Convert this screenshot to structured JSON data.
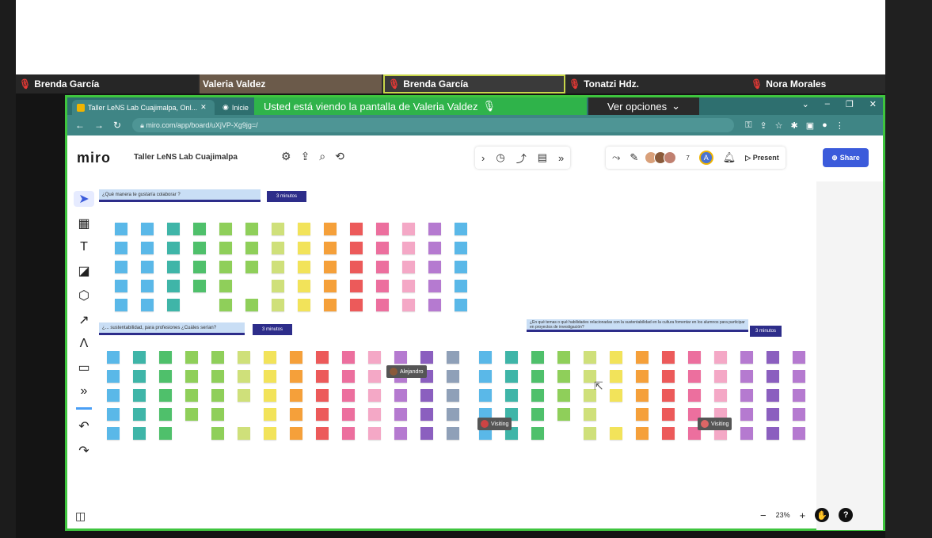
{
  "participants": [
    {
      "name": "Brenda García"
    },
    {
      "name": "Valeria Valdez"
    },
    {
      "name": "Brenda García"
    },
    {
      "name": "Tonatzi Hdz."
    },
    {
      "name": "Nora Morales"
    }
  ],
  "share_banner": {
    "text": "Usted está viendo la pantalla de Valeria Valdez",
    "options": "Ver opciones"
  },
  "browser": {
    "tab_active": "Taller LeNS Lab Cuajimalpa, Onl...",
    "tab_second": "Inicie",
    "url": "miro.com/app/board/uXjVP-Xg9jg=/"
  },
  "miro": {
    "logo": "miro",
    "board_name": "Taller LeNS Lab Cuajimalpa",
    "present": "Present",
    "share": "Share",
    "zoom": "23%",
    "user_initial": "A",
    "collab_count": "7"
  },
  "board": {
    "q1": "¿Qué manera te gustaría colaborar ?",
    "q1_tag": "3 minutos",
    "q2": "¿... sustentabilidad, para profesiones ¿Cuáles serían?",
    "q2_tag": "3 minutos",
    "q3": "¿En qué temas o qué habilidades relacionadas con la sustentabilidad en la cultura fomentar en los alumnos para participar en proyectos de investigación?",
    "q3_tag": "3 minutos",
    "cursor1": "Alejandro",
    "cursor2": "Visiting",
    "cursor3": "Visiting"
  },
  "note_colors": [
    "#5ab8e8",
    "#4fb3d6",
    "#3fb5a8",
    "#4fc06b",
    "#8fcf5a",
    "#cfe07a",
    "#f2e35a",
    "#f5a03a",
    "#ec5a5a",
    "#ec6f9e",
    "#f4a8c6",
    "#b57ad0",
    "#8b5fbf",
    "#8fa0b8"
  ]
}
